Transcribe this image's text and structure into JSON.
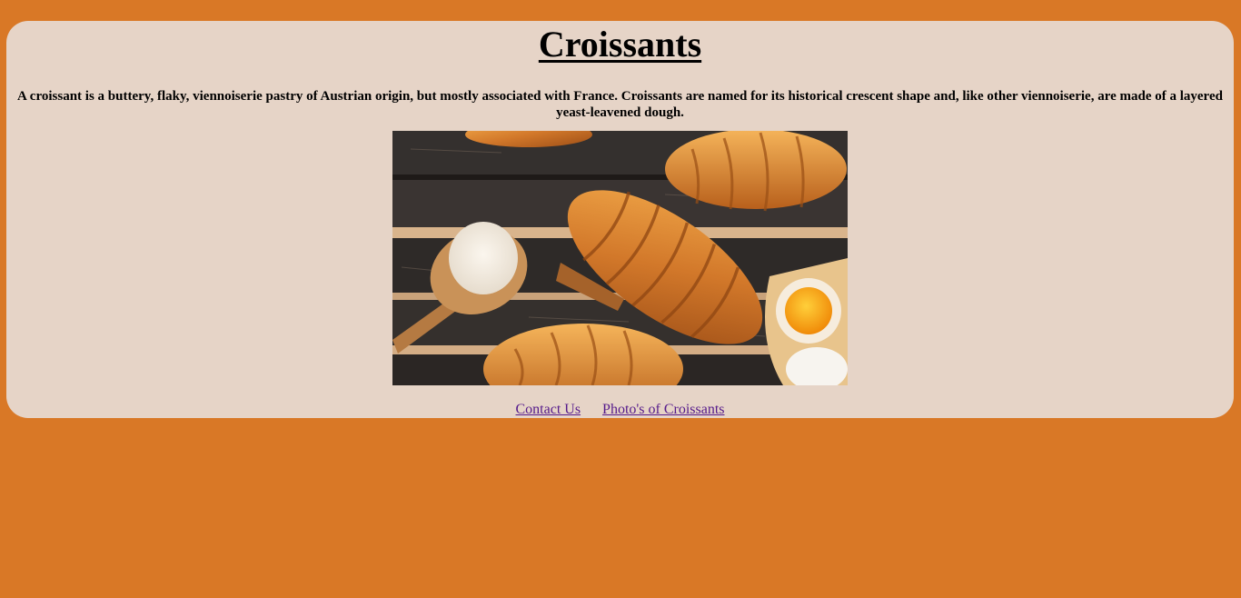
{
  "page": {
    "title": "Croissants",
    "description": "A croissant is a buttery, flaky, viennoiserie pastry of Austrian origin, but mostly associated with France. Croissants are named for its historical crescent shape and, like other viennoiserie, are made of a layered yeast-leavened dough."
  },
  "image": {
    "icon": "croissants-photo"
  },
  "nav": {
    "links": [
      {
        "label": "Contact Us"
      },
      {
        "label": "Photo's of Croissants"
      }
    ]
  },
  "colors": {
    "background": "#d97826",
    "card": "#e6d4c7",
    "link_visited": "#551a8b"
  }
}
